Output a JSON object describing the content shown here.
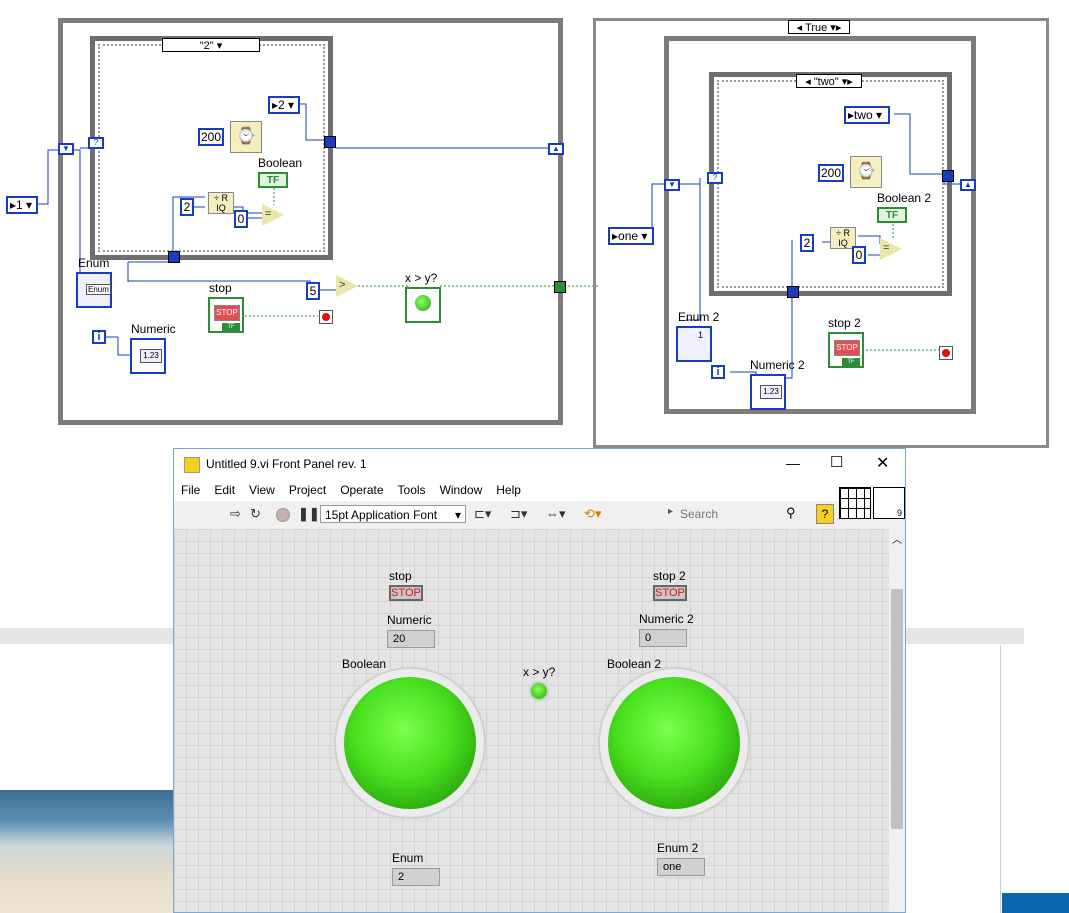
{
  "block_diagram": {
    "left_case_selector": "\"2\"",
    "left_while_enum_const": "1",
    "left_inner_enum_const": "2",
    "left_wait_const": "200",
    "left_div_const": "2",
    "left_zero_const": "0",
    "left_greater_const": "5",
    "labels": {
      "enum": "Enum",
      "boolean": "Boolean",
      "stop": "stop",
      "x_gt_y": "x > y?",
      "numeric": "Numeric",
      "enum2": "Enum 2",
      "boolean2": "Boolean 2",
      "stop2": "stop 2",
      "numeric2": "Numeric 2"
    },
    "right_case_selector": "True",
    "right_inner_selector": "\"two\"",
    "right_inner_enum_const": "two",
    "right_outer_enum_const": "one",
    "right_wait_const": "200",
    "right_div_const": "2",
    "right_zero_const": "0",
    "enum2_counter": "1"
  },
  "window": {
    "title": "Untitled 9.vi Front Panel rev. 1",
    "menu": [
      "File",
      "Edit",
      "View",
      "Project",
      "Operate",
      "Tools",
      "Window",
      "Help"
    ],
    "font_select": "15pt Application Font",
    "search_placeholder": "Search",
    "panel_count": "9"
  },
  "front_panel": {
    "stop_label": "stop",
    "stop_button": "STOP",
    "numeric_label": "Numeric",
    "numeric_value": "20",
    "boolean_label": "Boolean",
    "xy_label": "x > y?",
    "stop2_label": "stop 2",
    "stop2_button": "STOP",
    "numeric2_label": "Numeric 2",
    "numeric2_value": "0",
    "boolean2_label": "Boolean 2",
    "enum_label": "Enum",
    "enum_value": "2",
    "enum2_label": "Enum 2",
    "enum2_value": "one"
  },
  "colors": {
    "wire_blue": "#1a3cbf",
    "bool_green": "#2e8b3a",
    "led_green": "#49e01f"
  }
}
